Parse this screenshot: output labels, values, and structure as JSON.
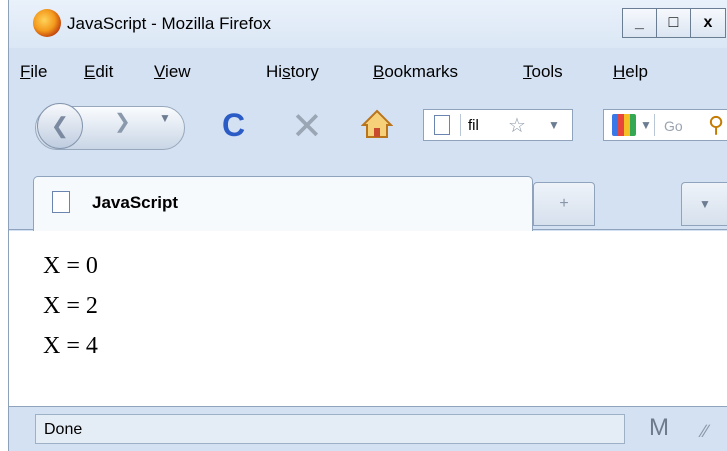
{
  "window": {
    "title": "JavaScript - Mozilla Firefox",
    "minimize_label": "_",
    "maximize_label": "□",
    "close_label": "x"
  },
  "menu": [
    {
      "label": "File",
      "accel": "F",
      "rest": "ile"
    },
    {
      "label": "Edit",
      "accel": "E",
      "rest": "dit"
    },
    {
      "label": "View",
      "accel": "V",
      "rest": "iew"
    },
    {
      "label": "History",
      "pre": "Hi",
      "accel": "s",
      "rest": "tory"
    },
    {
      "label": "Bookmarks",
      "accel": "B",
      "rest": "ookmarks"
    },
    {
      "label": "Tools",
      "accel": "T",
      "rest": "ools"
    },
    {
      "label": "Help",
      "accel": "H",
      "rest": "elp"
    }
  ],
  "toolbar": {
    "url_text": "fil",
    "search_placeholder": "Go"
  },
  "tabs": [
    {
      "label": "JavaScript",
      "active": true
    }
  ],
  "newtab_label": "+",
  "content": {
    "lines": [
      "X = 0",
      "X = 2",
      "X = 4"
    ]
  },
  "status": {
    "text": "Done"
  },
  "icons": {
    "back": "back-arrow-icon",
    "forward": "forward-arrow-icon",
    "reload": "reload-icon",
    "stop": "stop-icon",
    "home": "home-icon",
    "bookmark": "star-icon",
    "search_engine": "google-icon",
    "search": "magnifier-icon",
    "mail": "mail-icon"
  }
}
